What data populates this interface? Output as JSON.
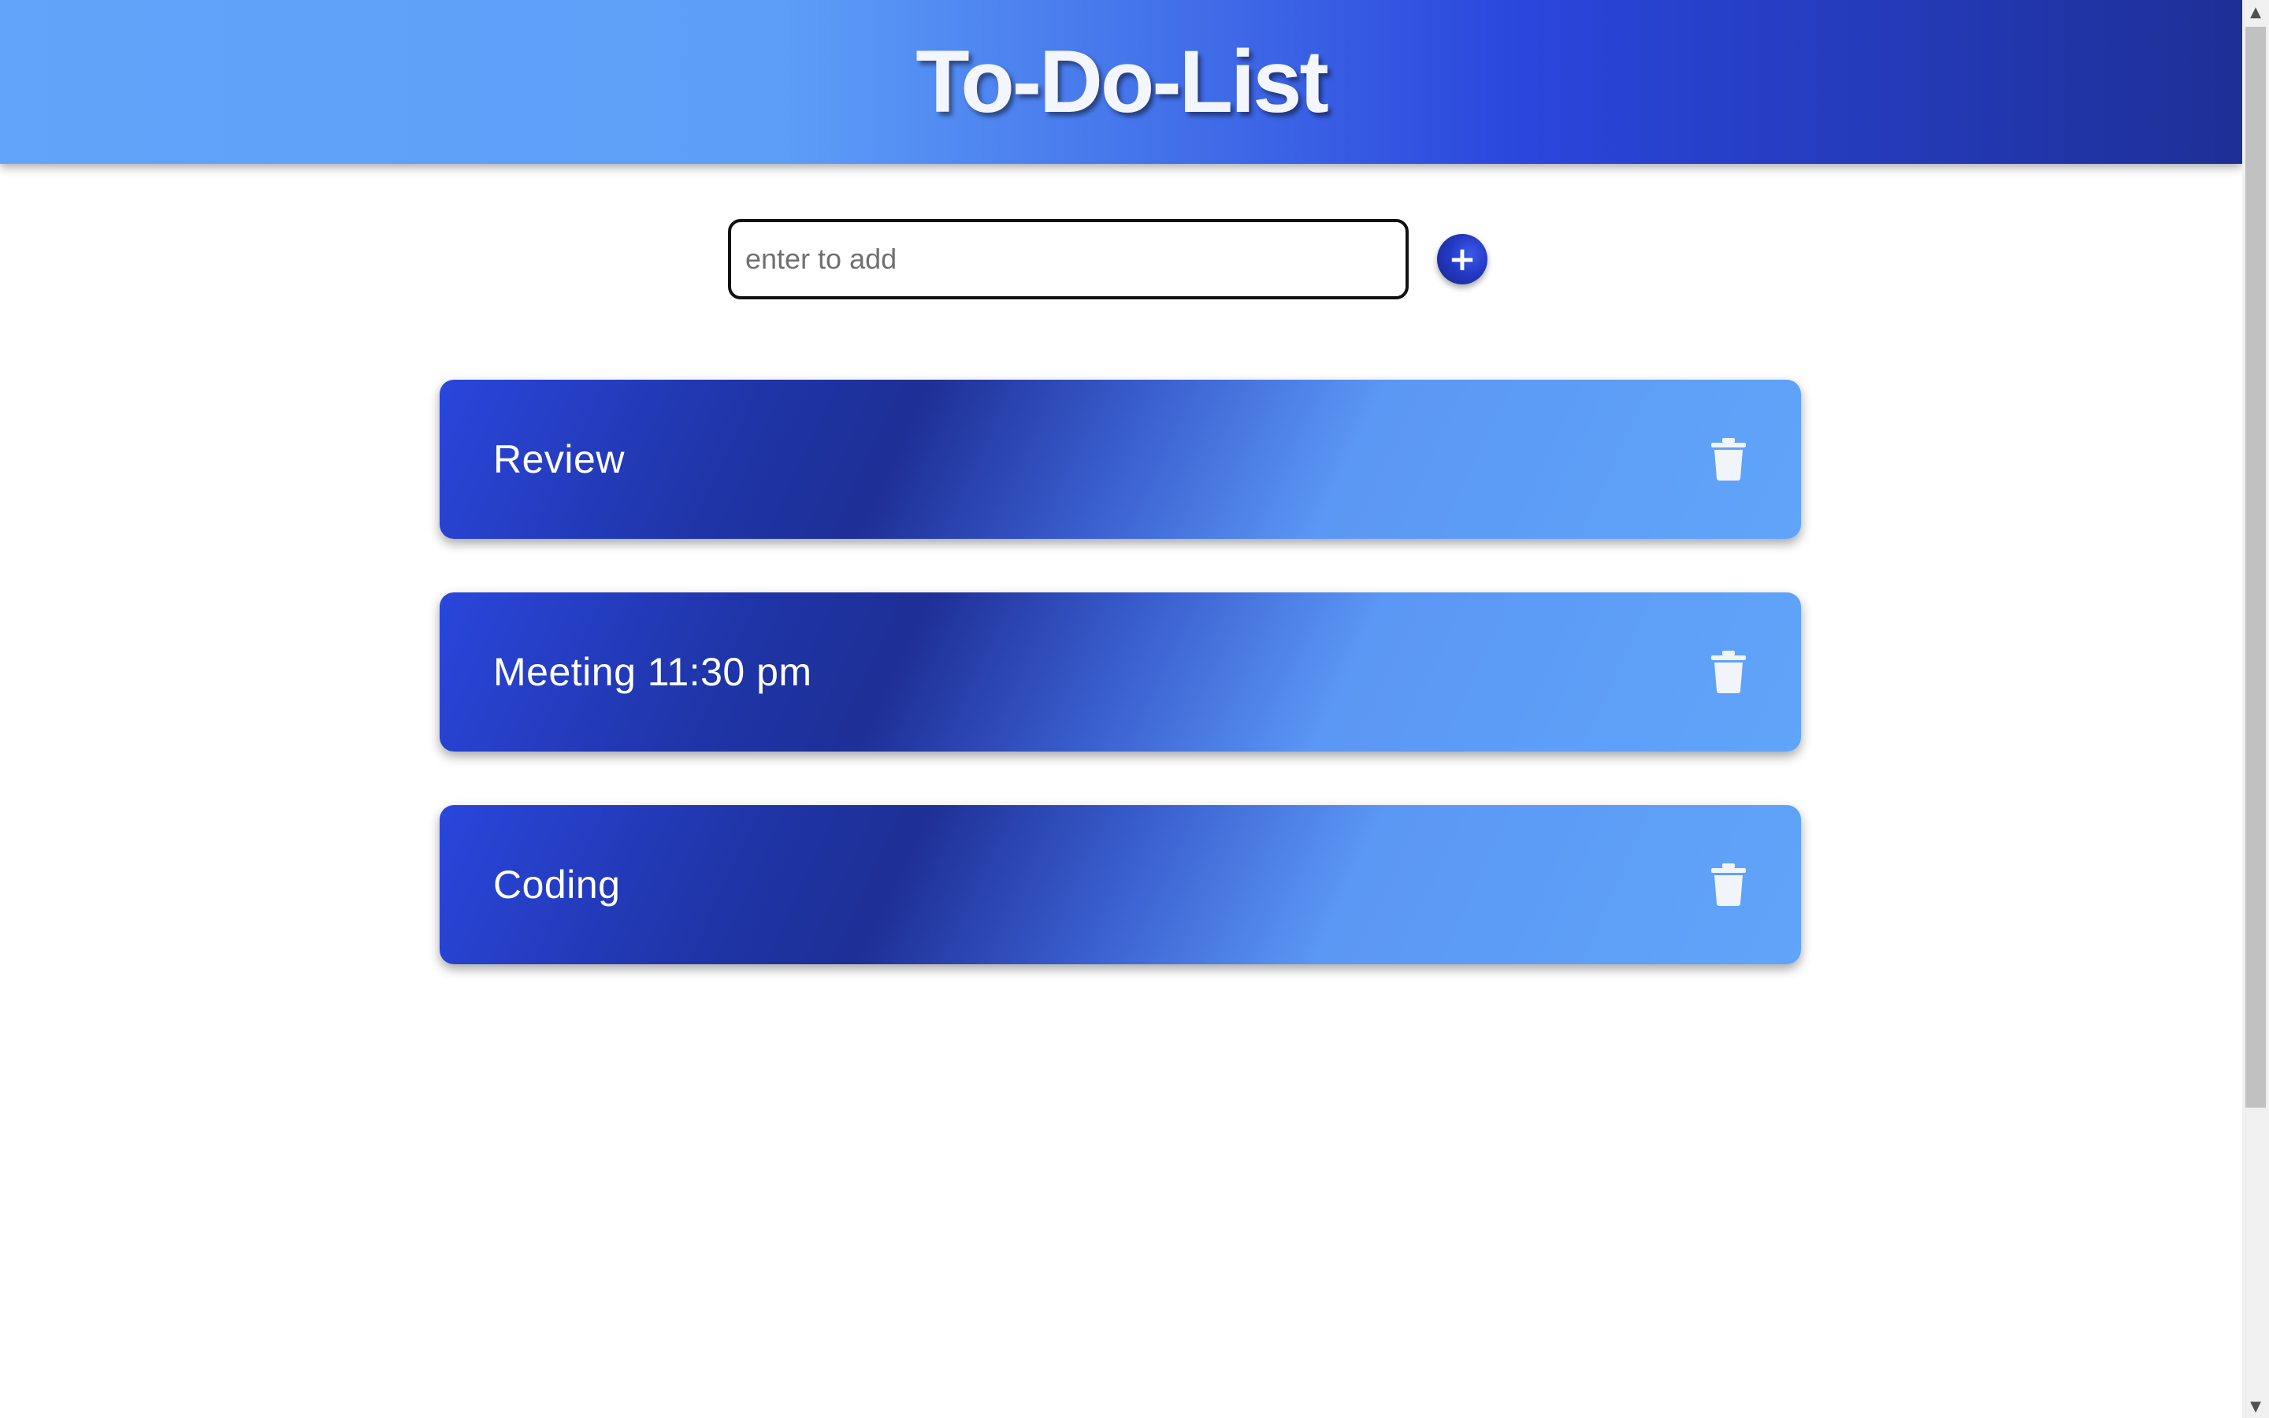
{
  "header": {
    "title": "To-Do-List"
  },
  "add_form": {
    "placeholder": "enter to add",
    "value": "",
    "add_button_label": "+"
  },
  "todos": [
    {
      "text": "Review",
      "delete_icon": "trash-icon"
    },
    {
      "text": "Meeting 11:30 pm",
      "delete_icon": "trash-icon"
    },
    {
      "text": "Coding",
      "delete_icon": "trash-icon"
    }
  ],
  "scrollbar": {
    "up_icon": "▲",
    "down_icon": "▼"
  },
  "colors": {
    "header_gradient": [
      "#60a5fa",
      "#2a46dc",
      "#1e2f96"
    ],
    "item_gradient": [
      "#2a46dc",
      "#1e2f96",
      "#60a5fa"
    ],
    "text": "#ffffff"
  }
}
